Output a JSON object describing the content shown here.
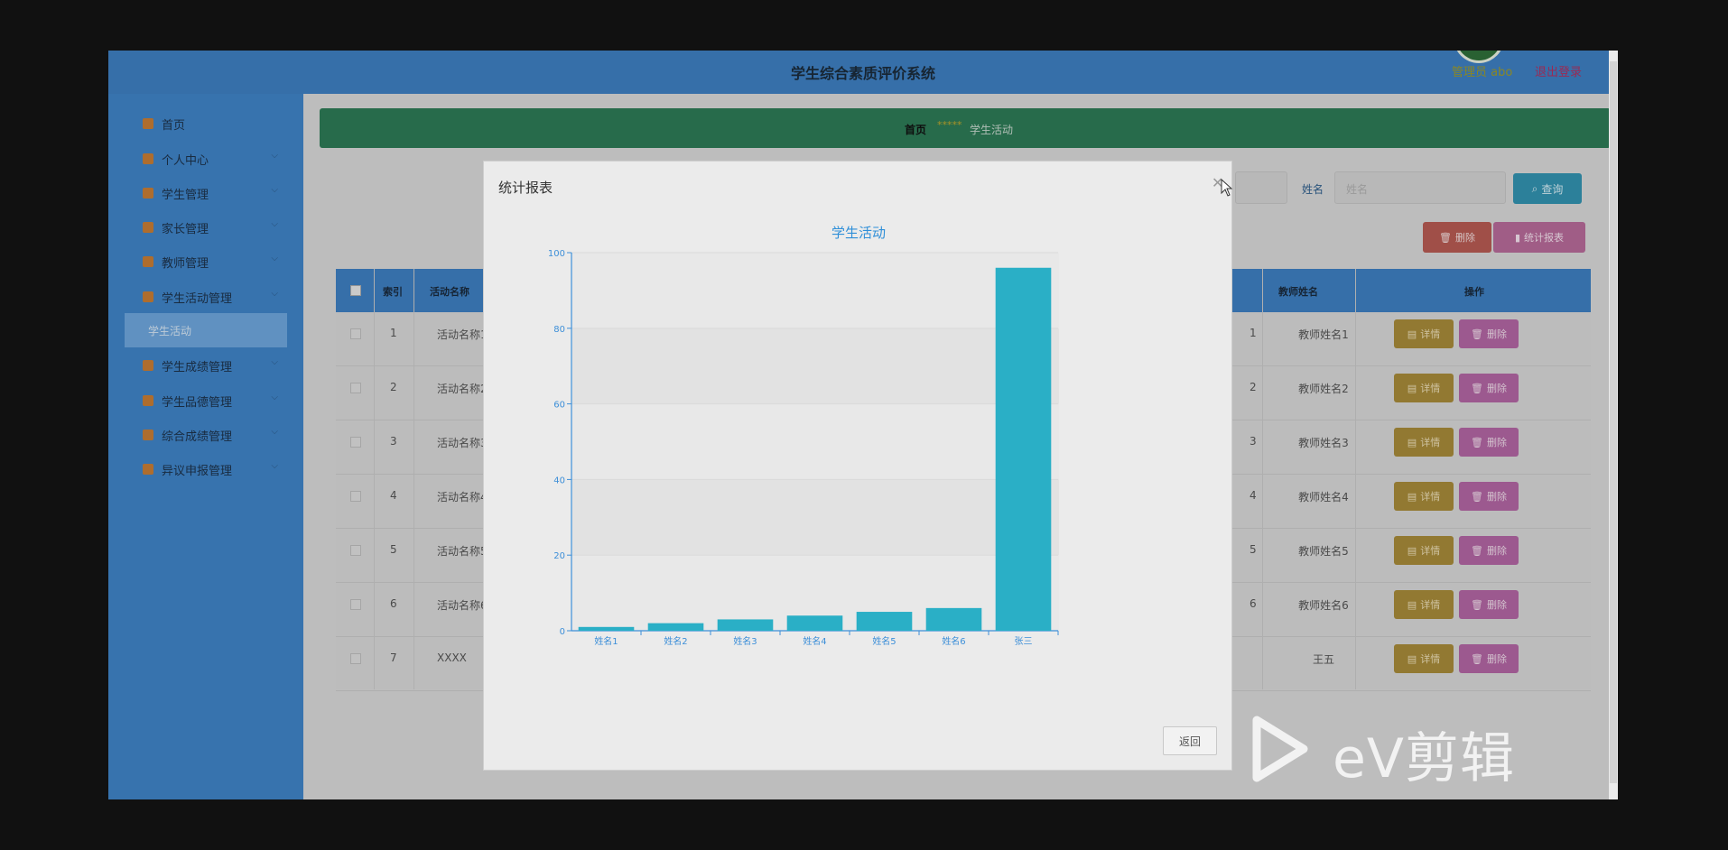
{
  "header": {
    "title": "学生综合素质评价系统",
    "admin": "管理员 abo",
    "logout": "退出登录"
  },
  "sidebar": {
    "items": [
      {
        "label": "首页"
      },
      {
        "label": "个人中心"
      },
      {
        "label": "学生管理"
      },
      {
        "label": "家长管理"
      },
      {
        "label": "教师管理"
      },
      {
        "label": "学生活动管理"
      },
      {
        "label": "学生成绩管理"
      },
      {
        "label": "学生品德管理"
      },
      {
        "label": "综合成绩管理"
      },
      {
        "label": "异议申报管理"
      }
    ],
    "active_sub": "学生活动"
  },
  "breadcrumb": {
    "home": "首页",
    "separator": "*****",
    "current": "学生活动"
  },
  "search": {
    "label": "姓名",
    "placeholder": "姓名",
    "button": "查询"
  },
  "actions": {
    "delete": "删除",
    "stats": "统计报表"
  },
  "table": {
    "headers": {
      "index": "索引",
      "activity": "活动名称",
      "teacher": "教师姓名",
      "ops": "操作"
    },
    "detail_label": "详情",
    "delete_label": "删除",
    "rows": [
      {
        "index": "1",
        "activity": "活动名称1",
        "mid": "1",
        "teacher": "教师姓名1"
      },
      {
        "index": "2",
        "activity": "活动名称2",
        "mid": "2",
        "teacher": "教师姓名2"
      },
      {
        "index": "3",
        "activity": "活动名称3",
        "mid": "3",
        "teacher": "教师姓名3"
      },
      {
        "index": "4",
        "activity": "活动名称4",
        "mid": "4",
        "teacher": "教师姓名4"
      },
      {
        "index": "5",
        "activity": "活动名称5",
        "mid": "5",
        "teacher": "教师姓名5"
      },
      {
        "index": "6",
        "activity": "活动名称6",
        "mid": "6",
        "teacher": "教师姓名6"
      },
      {
        "index": "7",
        "activity": "XXXX",
        "mid": "",
        "teacher": "王五"
      }
    ]
  },
  "modal": {
    "title": "统计报表",
    "return": "返回"
  },
  "chart_data": {
    "type": "bar",
    "title": "学生活动",
    "categories": [
      "姓名1",
      "姓名2",
      "姓名3",
      "姓名4",
      "姓名5",
      "姓名6",
      "张三"
    ],
    "values": [
      1,
      2,
      3,
      4,
      5,
      6,
      96
    ],
    "ylim": [
      0,
      100
    ],
    "yticks": [
      0,
      20,
      40,
      60,
      80,
      100
    ],
    "bar_color": "#2aafc6",
    "axis_color": "#3d8fd8",
    "title_color": "#2f8fd8"
  },
  "watermark": {
    "text": "eV剪辑"
  }
}
